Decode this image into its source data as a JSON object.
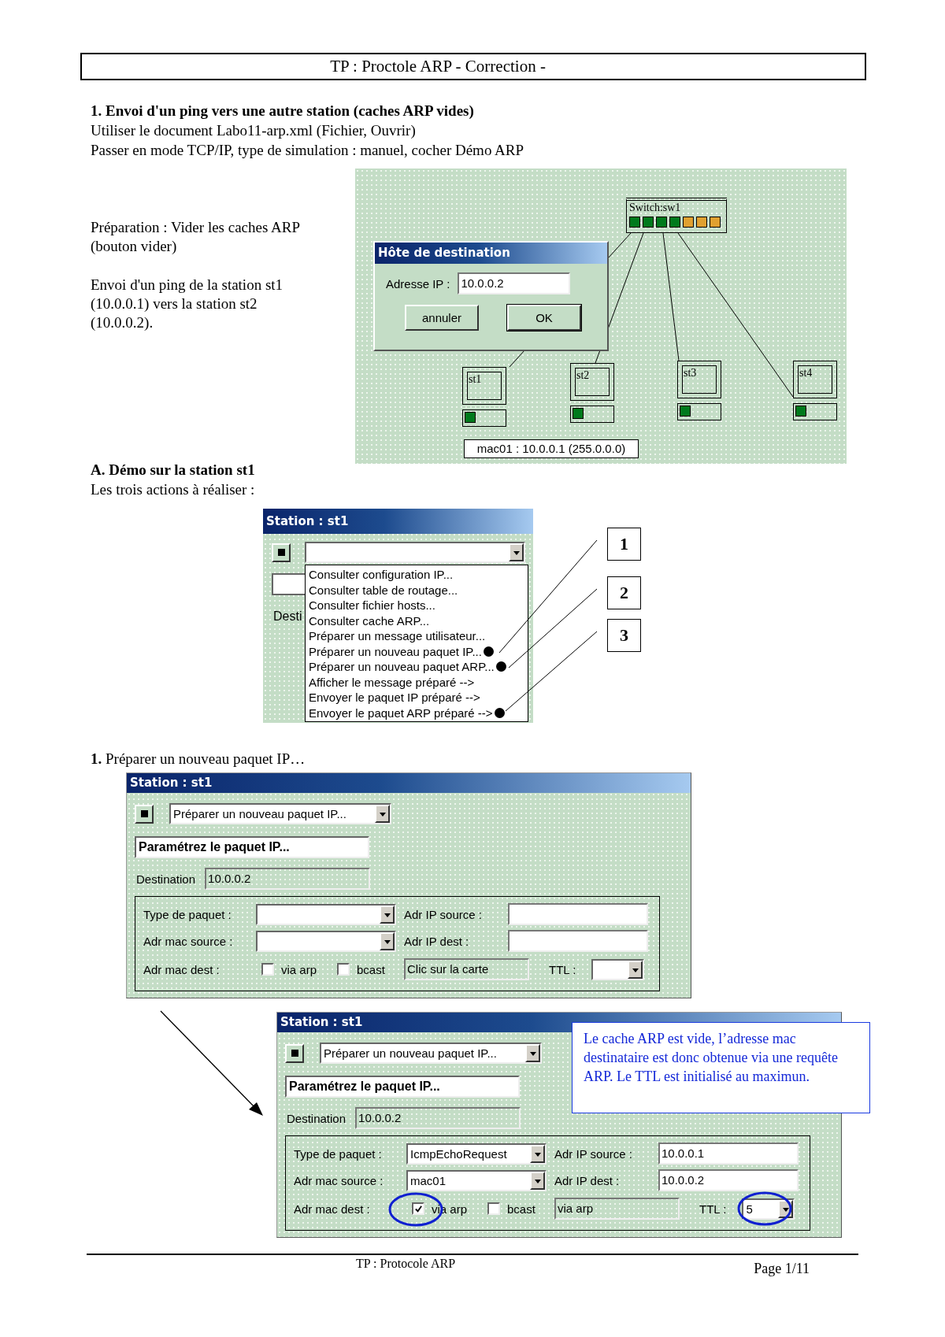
{
  "header": {
    "title": "TP : Proctole ARP - Correction -"
  },
  "section_1": {
    "heading": "1. Envoi d'un ping vers une autre station (caches ARP vides)",
    "lines": [
      "Utiliser le document Labo11-arp.xml (Fichier, Ouvrir)",
      "Passer en mode TCP/IP, type de simulation : manuel, cocher Démo ARP"
    ]
  },
  "preparation": {
    "paragraphs": [
      "Préparation : Vider les caches ARP (bouton vider)",
      "Envoi d'un ping de la station st1 (10.0.0.1) vers la station st2 (10.0.0.2)."
    ]
  },
  "network": {
    "switch": {
      "label": "Switch:sw1",
      "ports": [
        {
          "color": "#007a1c"
        },
        {
          "color": "#007a1c"
        },
        {
          "color": "#007a1c"
        },
        {
          "color": "#007a1c"
        },
        {
          "color": "#e0a030"
        },
        {
          "color": "#e0a030"
        },
        {
          "color": "#e0a030"
        }
      ]
    },
    "stations": [
      {
        "label": "st1"
      },
      {
        "label": "st2"
      },
      {
        "label": "st3"
      },
      {
        "label": "st4"
      }
    ],
    "status": "mac01 : 10.0.0.1 (255.0.0.0)",
    "dialog": {
      "title": "Hôte de destination",
      "field_label": "Adresse IP :",
      "value": "10.0.0.2",
      "buttons": [
        "annuler",
        "OK"
      ]
    }
  },
  "section_a": {
    "heading": "A. Démo sur la station st1",
    "intro": "Les trois actions à réaliser :"
  },
  "menu_window": {
    "title": "Station : st1",
    "label_fragment": "Desti",
    "items": [
      {
        "label": "Consulter configuration IP..."
      },
      {
        "label": "Consulter table de routage..."
      },
      {
        "label": "Consulter fichier hosts..."
      },
      {
        "label": "Consulter cache ARP..."
      },
      {
        "label": "Préparer un message utilisateur..."
      },
      {
        "label": "Préparer un nouveau paquet IP...",
        "callout": "1"
      },
      {
        "label": "Préparer un nouveau paquet ARP...",
        "callout": "2"
      },
      {
        "label": "Afficher le message préparé -->"
      },
      {
        "label": "Envoyer le paquet IP préparé -->"
      },
      {
        "label": "Envoyer le paquet ARP préparé -->",
        "callout": "3"
      }
    ]
  },
  "step_1": {
    "text": "**1.** Préparer un nouveau paquet IP…"
  },
  "windows": [
    {
      "title": "Station : st1",
      "action": "Préparer un nouveau paquet IP...",
      "prompt": "Paramétrez le paquet IP...",
      "destination_label": "Destination",
      "destination": "10.0.0.2",
      "packet_type_label": "Type de paquet :",
      "ip_source_label": "Adr IP source :",
      "mac_source_label": "Adr mac source :",
      "ip_dest_label": "Adr IP dest :",
      "mac_dest_label": "Adr mac dest :",
      "via_arp": {
        "label": "via arp",
        "checked": false
      },
      "bcast": {
        "label": "bcast",
        "checked": false
      },
      "mac_dest": "Clic sur la carte",
      "ttl_label": "TTL :"
    },
    {
      "title": "Station : st1",
      "action": "Préparer un nouveau paquet IP...",
      "prompt": "Paramétrez le paquet IP...",
      "destination_label": "Destination",
      "destination": "10.0.0.2",
      "packet_type_label": "Type de paquet :",
      "packet_type": "IcmpEchoRequest",
      "ip_source_label": "Adr IP source :",
      "ip_source": "10.0.0.1",
      "mac_source_label": "Adr mac source :",
      "mac_source": "mac01",
      "ip_dest_label": "Adr IP dest :",
      "ip_dest": "10.0.0.2",
      "mac_dest_label": "Adr mac dest :",
      "via_arp": {
        "label": "via arp",
        "checked": true,
        "circled": true
      },
      "bcast": {
        "label": "bcast",
        "checked": false
      },
      "mac_dest": "via arp",
      "ttl_label": "TTL :",
      "ttl": "5",
      "ttl_circled": true,
      "note": "Le cache ARP est vide, l’adresse mac destinataire est donc obtenue via une requête ARP. Le TTL est initialisé au maximun."
    }
  ],
  "footer": {
    "title": "TP : Protocole ARP",
    "page": "Page 1/11"
  }
}
